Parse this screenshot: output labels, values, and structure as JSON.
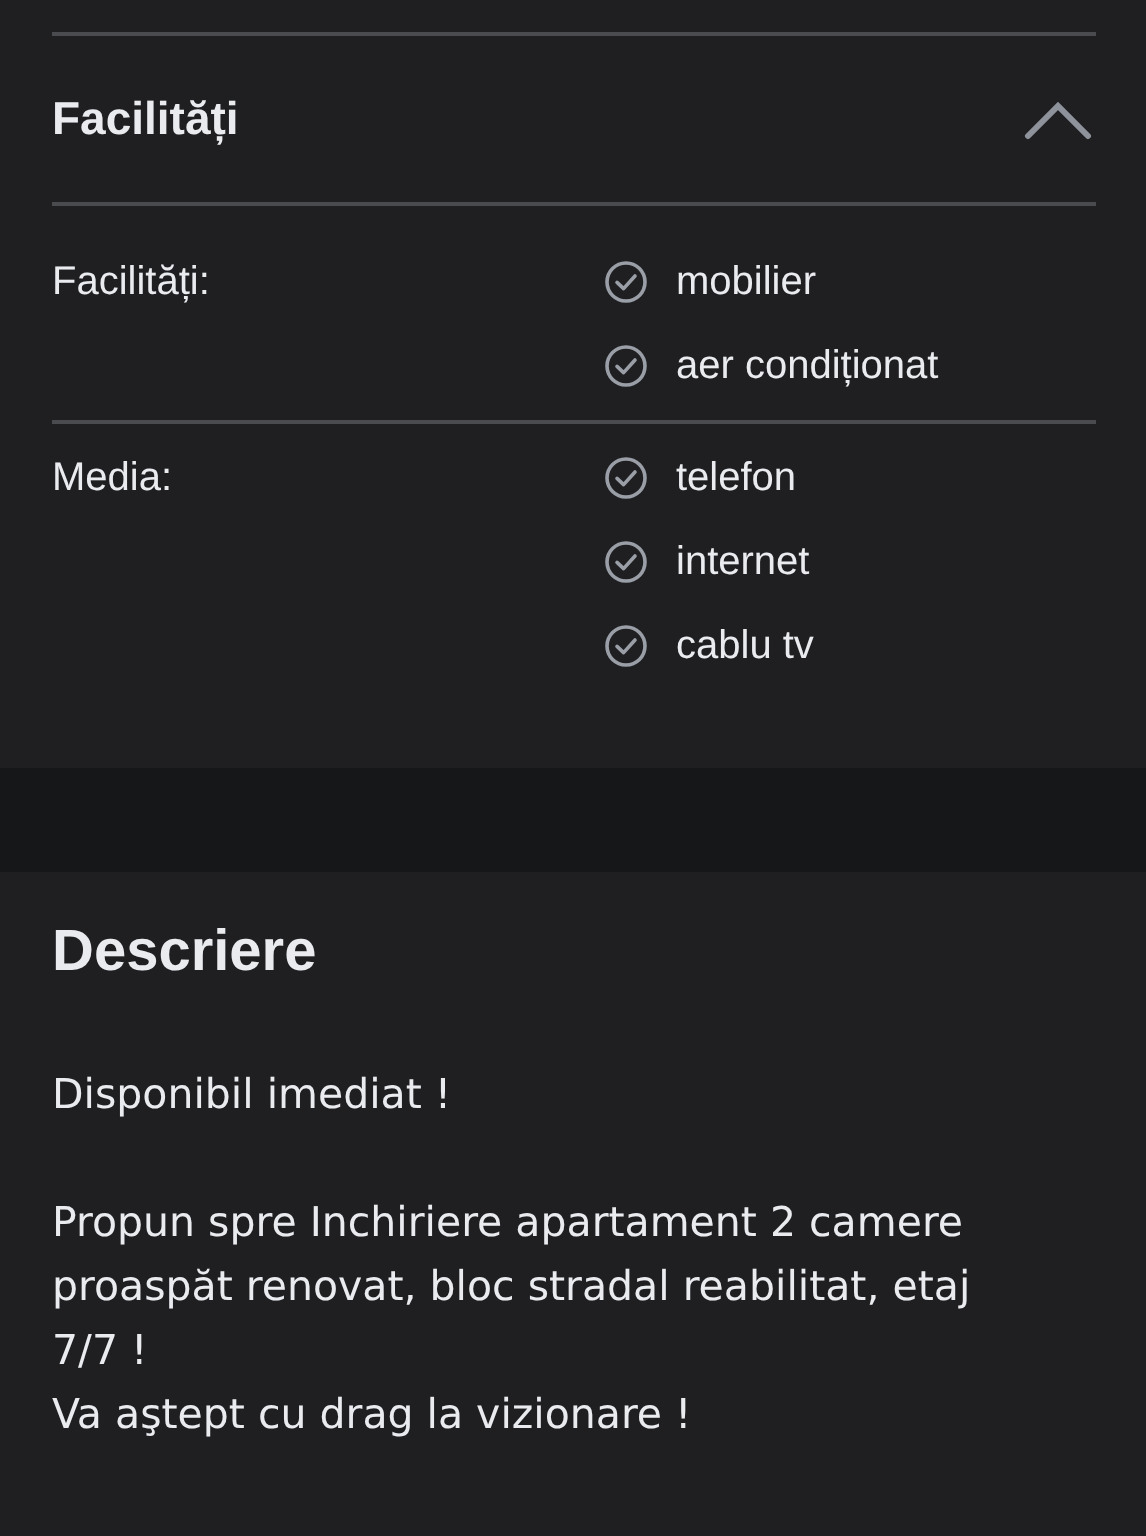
{
  "facilities_section": {
    "title": "Facilități",
    "expanded": true,
    "groups": [
      {
        "label": "Facilități:",
        "items": [
          {
            "text": "mobilier",
            "checked": true
          },
          {
            "text": "aer condiționat",
            "checked": true
          }
        ]
      },
      {
        "label": "Media:",
        "items": [
          {
            "text": "telefon",
            "checked": true
          },
          {
            "text": "internet",
            "checked": true
          },
          {
            "text": "cablu tv",
            "checked": true
          }
        ]
      }
    ]
  },
  "description_section": {
    "title": "Descriere",
    "paragraphs": [
      "Disponibil imediat !",
      "Propun spre Inchiriere apartament 2 camere proaspăt renovat, bloc stradal reabilitat, etaj 7/7 !\nVa aştept cu drag la vizionare !"
    ]
  }
}
